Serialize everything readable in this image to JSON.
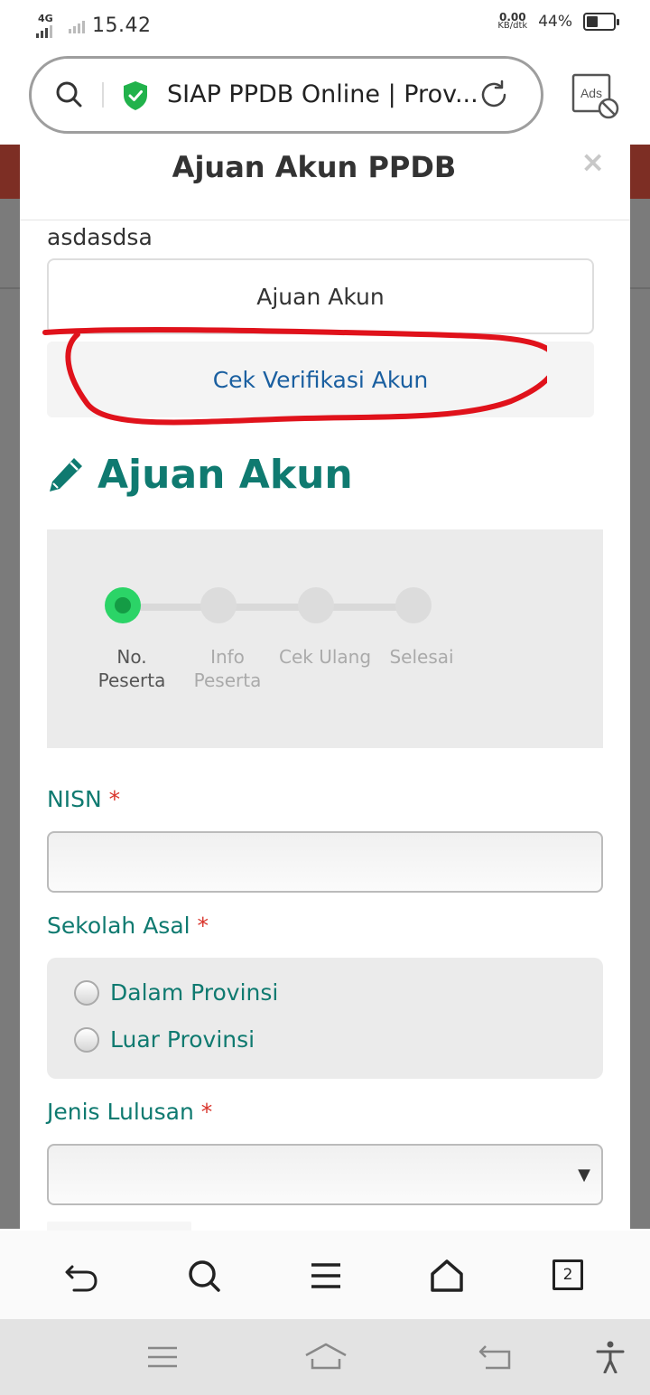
{
  "status_bar": {
    "network": "4G",
    "time": "15.42",
    "speed_value": "0.00",
    "speed_unit": "KB/dtk",
    "battery_percent": "44%",
    "battery_level": 0.44
  },
  "browser": {
    "page_title": "SIAP PPDB Online | Prov...",
    "ads_label": "Ads",
    "tab_count": "2",
    "icons": [
      "search-icon",
      "shield-check-icon",
      "reload-icon",
      "ads-block-icon",
      "back-icon",
      "search-icon",
      "menu-icon",
      "home-icon",
      "tabs-icon"
    ]
  },
  "modal": {
    "title": "Ajuan Akun PPDB",
    "close_label": "×",
    "previous_text": "asdasdsa",
    "ajuan_button": "Ajuan Akun",
    "cek_button": "Cek Verifikasi Akun",
    "section_title": "Ajuan Akun",
    "steps": [
      {
        "line1": "No.",
        "line2": "Peserta",
        "active": true
      },
      {
        "line1": "Info",
        "line2": "Peserta",
        "active": false
      },
      {
        "line1": "Cek Ulang",
        "line2": "",
        "active": false
      },
      {
        "line1": "Selesai",
        "line2": "",
        "active": false
      }
    ],
    "form": {
      "nisn_label": "NISN",
      "nisn_value": "",
      "sekolah_label": "Sekolah Asal",
      "sekolah_options": [
        "Dalam Provinsi",
        "Luar Provinsi"
      ],
      "jenis_label": "Jenis Lulusan",
      "jenis_value": "",
      "required_mark": "*"
    }
  },
  "colors": {
    "teal": "#0f7a70",
    "link_blue": "#1a5fa0",
    "annotation_red": "#e0121b",
    "step_active": "#2bd467"
  }
}
